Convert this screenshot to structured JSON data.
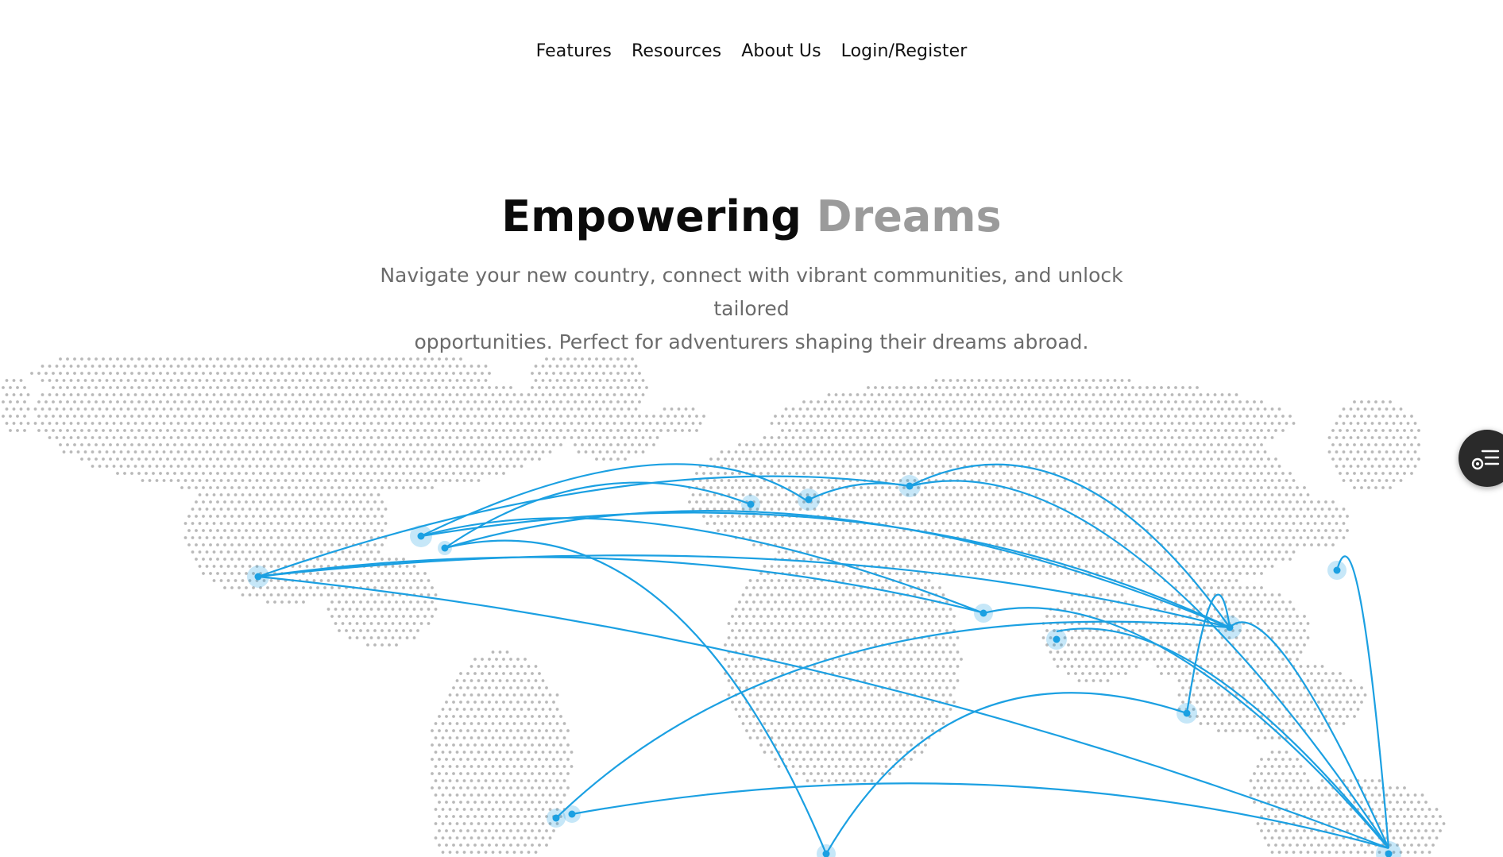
{
  "nav": {
    "items": [
      {
        "label": "Features"
      },
      {
        "label": "Resources"
      },
      {
        "label": "About Us"
      },
      {
        "label": "Login/Register"
      }
    ]
  },
  "hero": {
    "title_primary": "Empowering",
    "title_accent": "Dreams",
    "subtitle_line1": "Navigate your new country, connect with vibrant communities, and unlock tailored",
    "subtitle_line2": "opportunities. Perfect for adventurers shaping their dreams abroad."
  },
  "map": {
    "route_color": "#1ba0e2",
    "node_color": "#1ba0e2",
    "dot_color": "#b9b9b9"
  },
  "floating_button": {
    "icon": "menu-settings-icon"
  }
}
